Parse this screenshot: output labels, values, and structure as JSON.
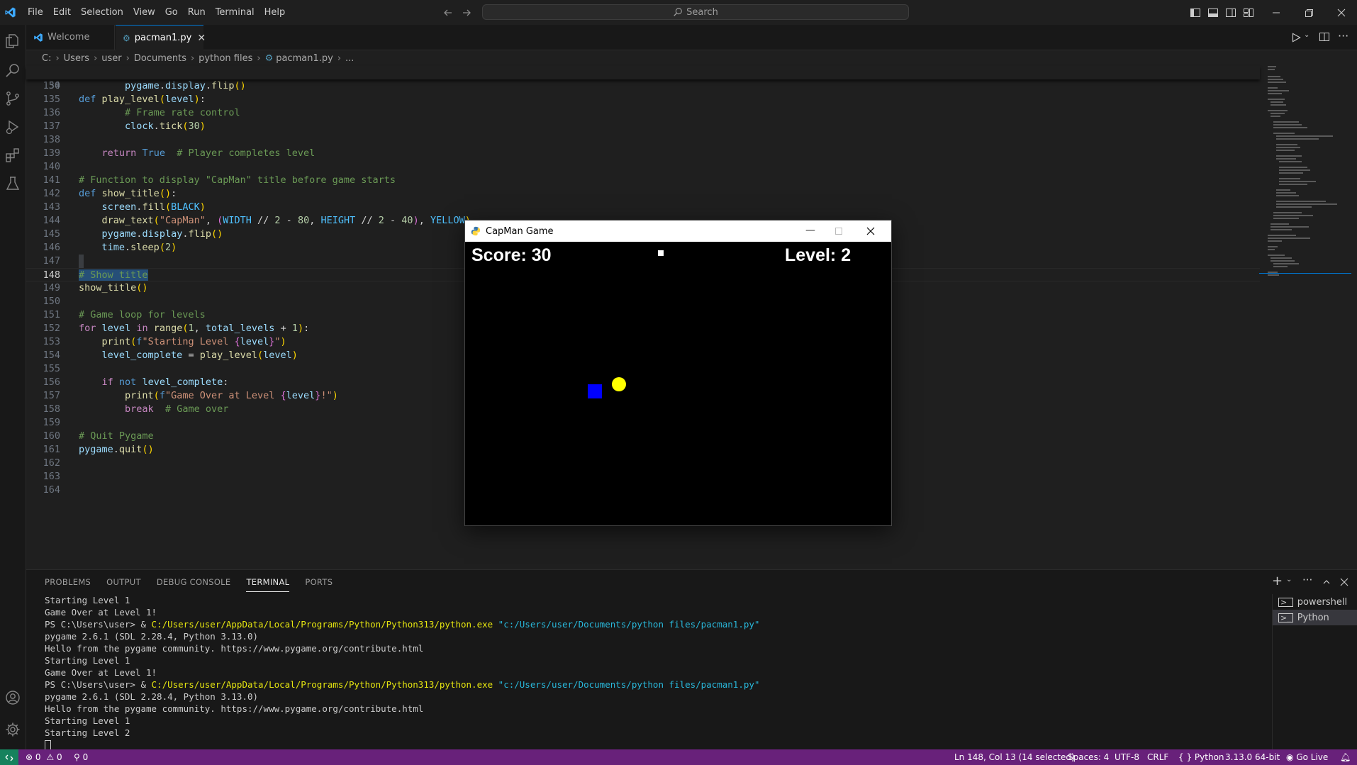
{
  "menu": [
    "File",
    "Edit",
    "Selection",
    "View",
    "Go",
    "Run",
    "Terminal",
    "Help"
  ],
  "search": {
    "label": "Search"
  },
  "tabs": [
    {
      "label": "Welcome"
    },
    {
      "label": "pacman1.py"
    }
  ],
  "breadcrumb": [
    "C:",
    "Users",
    "user",
    "Documents",
    "python files",
    "pacman1.py",
    "..."
  ],
  "editor": {
    "sticky_line_number": "50",
    "line_numbers": [
      "134",
      "135",
      "136",
      "137",
      "138",
      "139",
      "140",
      "141",
      "142",
      "143",
      "144",
      "145",
      "146",
      "147",
      "148",
      "149",
      "150",
      "151",
      "152",
      "153",
      "154",
      "155",
      "156",
      "157",
      "158",
      "159",
      "160",
      "161",
      "162",
      "163",
      "164"
    ]
  },
  "game_window": {
    "title": "CapMan Game",
    "score_text": "Score: 30",
    "level_text": "Level: 2",
    "colors": {
      "player": "#ffff00",
      "ghost": "#0000ff",
      "pellet": "#ffffff",
      "background": "#000000"
    }
  },
  "panel": {
    "tabs": [
      "PROBLEMS",
      "OUTPUT",
      "DEBUG CONSOLE",
      "TERMINAL",
      "PORTS"
    ],
    "active_tab": "TERMINAL",
    "terminal_lines": [
      {
        "text": "Starting Level 1"
      },
      {
        "text": "Game Over at Level 1!"
      },
      {
        "prompt": "PS C:\\Users\\user> & ",
        "path": "C:/Users/user/AppData/Local/Programs/Python/Python313/python.exe",
        "arg": " \"c:/Users/user/Documents/python files/pacman1.py\""
      },
      {
        "text": "pygame 2.6.1 (SDL 2.28.4, Python 3.13.0)"
      },
      {
        "text": "Hello from the pygame community. https://www.pygame.org/contribute.html"
      },
      {
        "text": "Starting Level 1"
      },
      {
        "text": "Game Over at Level 1!"
      },
      {
        "prompt": "PS C:\\Users\\user> & ",
        "path": "C:/Users/user/AppData/Local/Programs/Python/Python313/python.exe",
        "arg": " \"c:/Users/user/Documents/python files/pacman1.py\""
      },
      {
        "text": "pygame 2.6.1 (SDL 2.28.4, Python 3.13.0)"
      },
      {
        "text": "Hello from the pygame community. https://www.pygame.org/contribute.html"
      },
      {
        "text": "Starting Level 1"
      },
      {
        "text": "Starting Level 2"
      }
    ],
    "terminal_list": [
      "powershell",
      "Python"
    ]
  },
  "statusbar": {
    "errors": "0",
    "warnings": "0",
    "ports": "0",
    "cursor": "Ln 148, Col 13 (14 selected)",
    "spaces": "Spaces: 4",
    "encoding": "UTF-8",
    "eol": "CRLF",
    "language": "Python",
    "interpreter": "3.13.0 64-bit",
    "golive": "Go Live"
  },
  "theme": {
    "accent": "#68217a",
    "vscode_blue": "#0078d4"
  }
}
